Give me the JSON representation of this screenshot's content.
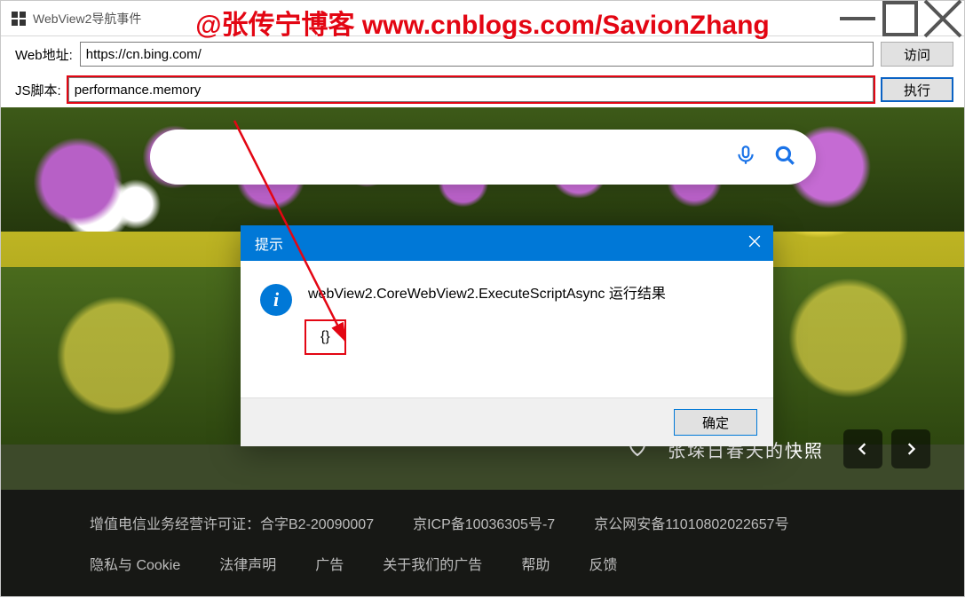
{
  "window": {
    "title": "WebView2导航事件",
    "min_label": "minimize",
    "max_label": "maximize",
    "close_label": "close"
  },
  "toolbar": {
    "url_label": "Web地址:",
    "url_value": "https://cn.bing.com/",
    "go_label": "访问",
    "js_label": "JS脚本:",
    "js_value": "performance.memory",
    "exec_label": "执行"
  },
  "watermark": "@张传宁博客 www.cnblogs.com/SavionZhang",
  "bing": {
    "caption": "张垛日春天的快照",
    "footer_row1": [
      "增值电信业务经营许可证：合字B2-20090007",
      "京ICP备10036305号-7",
      "京公网安备11010802022657号"
    ],
    "footer_row2": [
      "隐私与 Cookie",
      "法律声明",
      "广告",
      "关于我们的广告",
      "帮助",
      "反馈"
    ],
    "mic_icon": "microphone-icon",
    "search_icon": "search-icon"
  },
  "dialog": {
    "title": "提示",
    "message": "webView2.CoreWebView2.ExecuteScriptAsync 运行结果",
    "result": "{}",
    "ok_label": "确定"
  },
  "colors": {
    "accent": "#0078d7",
    "annotation": "#e30613"
  }
}
